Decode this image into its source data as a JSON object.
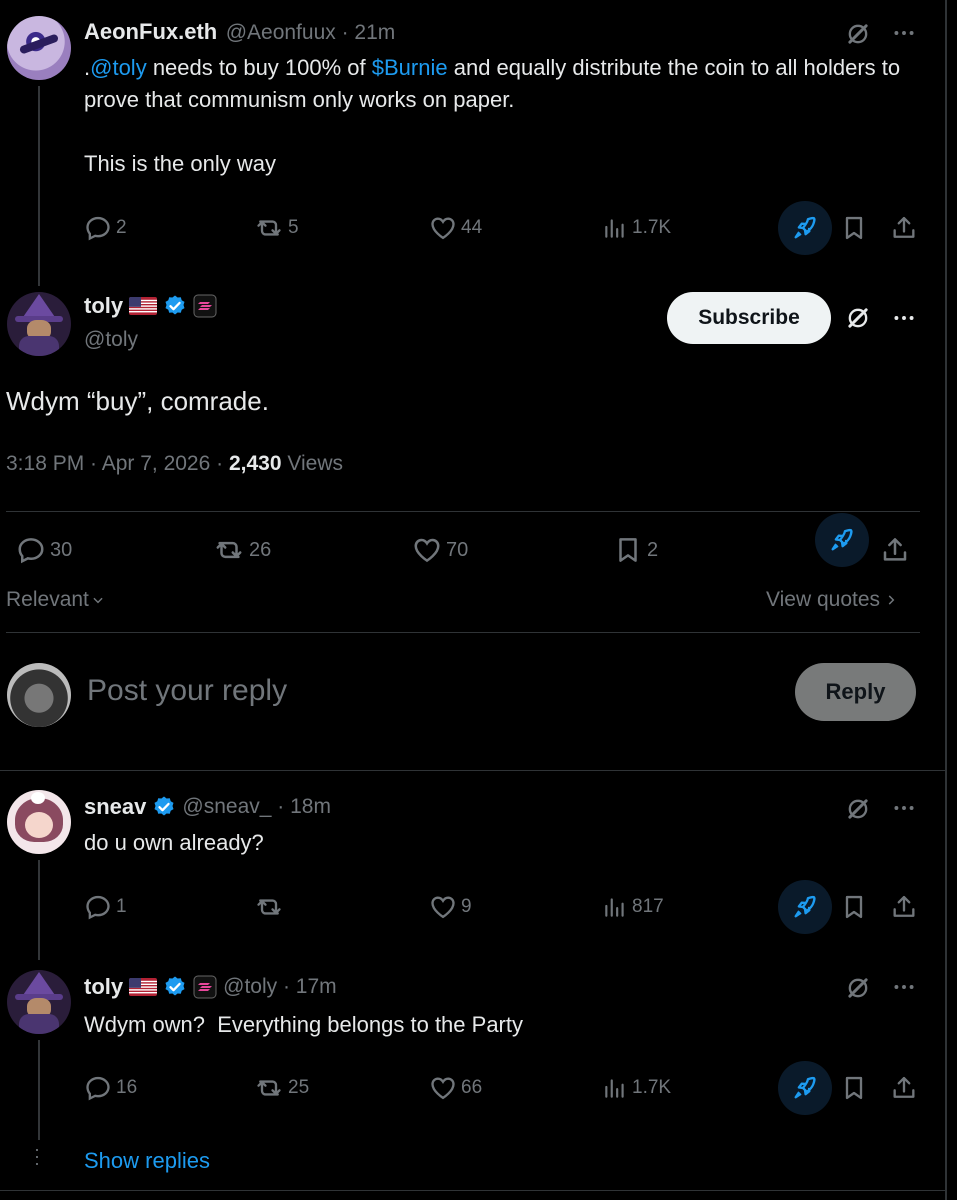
{
  "colors": {
    "accent": "#1d9bf0",
    "muted": "#71767b",
    "text": "#e7e9ea",
    "background": "#000000"
  },
  "post1": {
    "name": "AeonFux.eth",
    "handle_time": "@Aeonfuux · 21m",
    "text_prefix": ".",
    "mention": "@toly",
    "text_mid": " needs to buy 100% of ",
    "cashtag": "$Burnie",
    "text_suffix": " and equally distribute the coin to all holders to prove that communism only works on paper.",
    "text_line2": "This is the only way",
    "replies": "2",
    "reposts": "5",
    "likes": "44",
    "views": "1.7K"
  },
  "main": {
    "name": "toly",
    "handle": "@toly",
    "subscribe_label": "Subscribe",
    "text": "Wdym “buy”, comrade.",
    "time_date": "3:18 PM · Apr 7, 2026 · ",
    "views_count": "2,430",
    "views_label": " Views",
    "replies": "30",
    "reposts": "26",
    "likes": "70",
    "bookmarks": "2",
    "sort_label": "Relevant",
    "view_quotes": "View quotes"
  },
  "composer": {
    "placeholder": "Post your reply",
    "reply_label": "Reply"
  },
  "reply1": {
    "name": "sneav",
    "handle_time": "@sneav_ · 18m",
    "text": "do u own already?",
    "replies": "1",
    "reposts": "",
    "likes": "9",
    "views": "817"
  },
  "reply2": {
    "name": "toly",
    "handle_time": "@toly · 17m",
    "text": "Wdym own?  Everything belongs to the Party",
    "replies": "16",
    "reposts": "25",
    "likes": "66",
    "views": "1.7K"
  },
  "show_replies": "Show replies",
  "icons": [
    "reply-icon",
    "repost-icon",
    "like-icon",
    "views-icon",
    "rocket-icon",
    "bookmark-icon",
    "share-icon",
    "grok-icon",
    "more-icon",
    "verified-icon",
    "us-flag-icon",
    "solana-icon",
    "chevron-down-icon",
    "chevron-right-icon"
  ]
}
